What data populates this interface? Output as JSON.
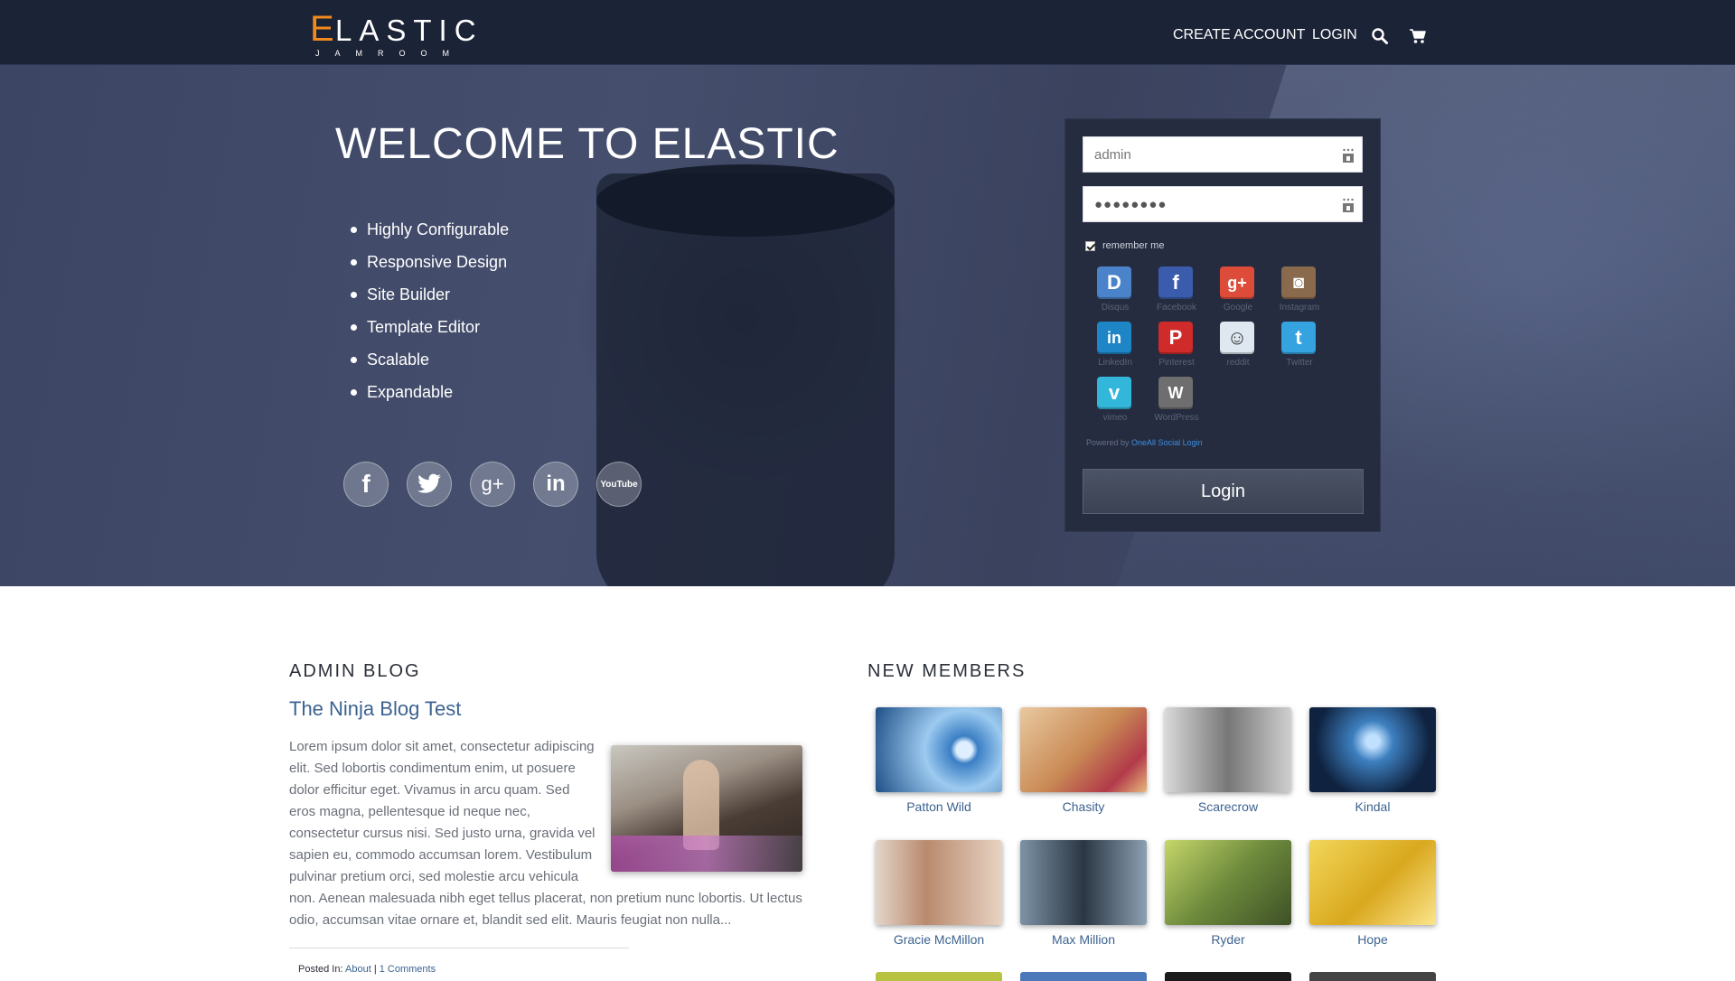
{
  "header": {
    "logo": {
      "letter": "E",
      "rest": "LASTIC",
      "sub": "JAMROOM"
    },
    "nav": {
      "create_account": "CREATE ACCOUNT",
      "login": "LOGIN"
    },
    "icons": [
      "search-icon",
      "cart-icon"
    ]
  },
  "hero": {
    "title": "WELCOME TO ELASTIC",
    "features": [
      "Highly Configurable",
      "Responsive Design",
      "Site Builder",
      "Template Editor",
      "Scalable",
      "Expandable"
    ],
    "socials": [
      {
        "name": "facebook-icon",
        "glyph": "f"
      },
      {
        "name": "twitter-icon",
        "glyph": "t"
      },
      {
        "name": "google-plus-icon",
        "glyph": "g+"
      },
      {
        "name": "linkedin-icon",
        "glyph": "in"
      },
      {
        "name": "youtube-icon",
        "glyph": "YouTube"
      }
    ]
  },
  "login_form": {
    "username_value": "admin",
    "password_value": "●●●●●●●●",
    "remember_label": "remember me",
    "remember_checked": true,
    "providers": [
      {
        "label": "Disqus",
        "glyph": "D",
        "color": "#4a83c9"
      },
      {
        "label": "Facebook",
        "glyph": "f",
        "color": "#3b5cad"
      },
      {
        "label": "Google",
        "glyph": "g+",
        "color": "#dd4b39"
      },
      {
        "label": "Instagram",
        "glyph": "◙",
        "color": "#8a6a4c"
      },
      {
        "label": "LinkedIn",
        "glyph": "in",
        "color": "#1e86c7"
      },
      {
        "label": "Pinterest",
        "glyph": "P",
        "color": "#cf2b2b"
      },
      {
        "label": "reddit",
        "glyph": "☺",
        "color": "#dfe7f0"
      },
      {
        "label": "Twitter",
        "glyph": "t",
        "color": "#34a3e0"
      },
      {
        "label": "vimeo",
        "glyph": "v",
        "color": "#32b7db"
      },
      {
        "label": "WordPress",
        "glyph": "W",
        "color": "#6e6e6e"
      }
    ],
    "powered_prefix": "Powered by",
    "powered_link": "OneAll Social Login",
    "login_button": "Login"
  },
  "blog": {
    "section_title": "ADMIN BLOG",
    "post_title": "The Ninja Blog Test",
    "post_body": "Lorem ipsum dolor sit amet, consectetur adipiscing elit. Sed lobortis condimentum enim, ut posuere dolor efficitur eget. Vivamus in arcu quam. Sed eros magna, pellentesque id neque nec, consectetur cursus nisi. Sed justo urna, gravida vel sapien eu, commodo accumsan lorem. Vestibulum pulvinar pretium orci, sed molestie arcu vehicula non. Aenean malesuada nibh eget tellus placerat, non pretium nunc lobortis. Ut lectus odio, accumsan vitae ornare et, blandit sed elit. Mauris feugiat non nulla...",
    "posted_in_label": "Posted In:",
    "posted_in_category": "About",
    "separator": "|",
    "comments": "1 Comments"
  },
  "members": {
    "section_title": "NEW MEMBERS",
    "list": [
      {
        "name": "Patton Wild",
        "color": "#6f9ec9"
      },
      {
        "name": "Chasity",
        "color": "#d6a06a"
      },
      {
        "name": "Scarecrow",
        "color": "#9a9a9a"
      },
      {
        "name": "Kindal",
        "color": "#1f3a5a"
      },
      {
        "name": "Gracie McMillon",
        "color": "#b89076"
      },
      {
        "name": "Max Million",
        "color": "#5d6f80"
      },
      {
        "name": "Ryder",
        "color": "#8aa146"
      },
      {
        "name": "Hope",
        "color": "#e3b92a"
      }
    ]
  }
}
